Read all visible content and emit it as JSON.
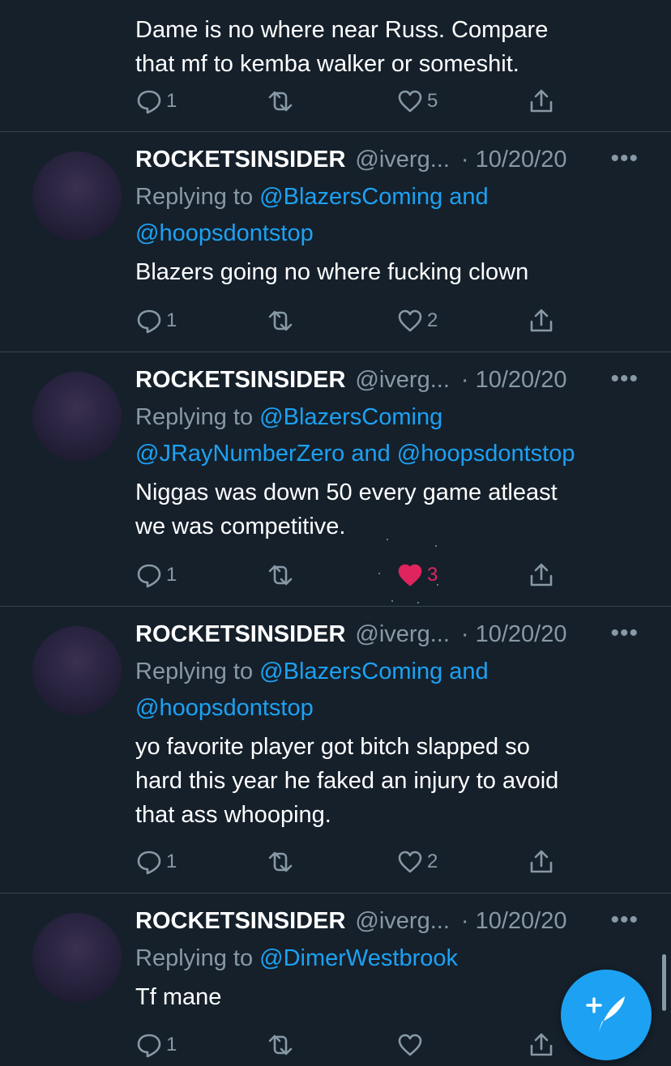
{
  "tweets": [
    {
      "body": [
        "Dame is no where near Russ. Compare",
        "that mf to kemba walker or someshit."
      ],
      "reply_count": "1",
      "retweet_count": "",
      "like_count": "5",
      "liked": false
    },
    {
      "name": "ROCKETSINSIDER",
      "handle": "@iverg...",
      "date": "· 10/20/20",
      "replying_prefix": "Replying to ",
      "replying_lines": [
        [
          "@BlazersComing",
          " and"
        ],
        [
          "@hoopsdontstop",
          ""
        ]
      ],
      "body": [
        "Blazers going no where fucking clown"
      ],
      "reply_count": "1",
      "retweet_count": "",
      "like_count": "2",
      "liked": false
    },
    {
      "name": "ROCKETSINSIDER",
      "handle": "@iverg...",
      "date": "· 10/20/20",
      "replying_prefix": "Replying to ",
      "replying_lines": [
        [
          "@BlazersComing",
          ""
        ],
        [
          "@JRayNumberZero and @hoopsdontstop",
          ""
        ]
      ],
      "body": [
        "Niggas was down 50 every game atleast",
        "we was competitive."
      ],
      "reply_count": "1",
      "retweet_count": "",
      "like_count": "3",
      "liked": true
    },
    {
      "name": "ROCKETSINSIDER",
      "handle": "@iverg...",
      "date": "· 10/20/20",
      "replying_prefix": "Replying to ",
      "replying_lines": [
        [
          "@BlazersComing",
          " and"
        ],
        [
          "@hoopsdontstop",
          ""
        ]
      ],
      "body": [
        "yo favorite player got bitch slapped so",
        "hard this year he faked an injury to avoid",
        "that ass whooping."
      ],
      "reply_count": "1",
      "retweet_count": "",
      "like_count": "2",
      "liked": false
    },
    {
      "name": "ROCKETSINSIDER",
      "handle": "@iverg...",
      "date": "· 10/20/20",
      "replying_prefix": "Replying to ",
      "replying_lines": [
        [
          "@DimerWestbrook",
          ""
        ]
      ],
      "body": [
        "Tf mane"
      ],
      "reply_count": "1",
      "retweet_count": "",
      "like_count": "",
      "liked": false
    }
  ],
  "more_glyph": "•••",
  "colors": {
    "background": "#15202b",
    "secondary_text": "#8899a6",
    "link": "#1da1f2",
    "like": "#e0245e",
    "divider": "#38444d"
  },
  "icons": {
    "reply": "reply-icon",
    "retweet": "retweet-icon",
    "like": "heart-icon",
    "share": "share-icon",
    "compose": "compose-tweet-icon"
  }
}
